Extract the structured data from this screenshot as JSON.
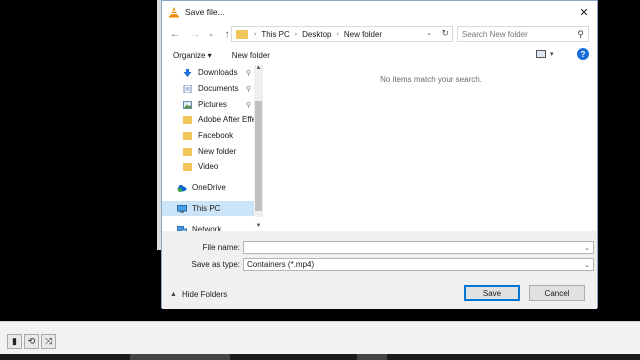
{
  "dialog": {
    "title": "Save file...",
    "close_glyph": "✕"
  },
  "address": {
    "crumbs": [
      "This PC",
      "Desktop",
      "New folder"
    ],
    "search_placeholder": "Search New folder"
  },
  "toolbar": {
    "organize_label": "Organize ▾",
    "new_folder_label": "New folder",
    "help_glyph": "?"
  },
  "nav": {
    "items": [
      {
        "label": "Downloads",
        "icon": "download-icon",
        "pinned": true
      },
      {
        "label": "Documents",
        "icon": "documents-icon",
        "pinned": true
      },
      {
        "label": "Pictures",
        "icon": "pictures-icon",
        "pinned": true
      },
      {
        "label": "Adobe After Effe",
        "icon": "folder-icon",
        "pinned": false
      },
      {
        "label": "Facebook",
        "icon": "folder-icon",
        "pinned": false
      },
      {
        "label": "New folder",
        "icon": "folder-icon",
        "pinned": false
      },
      {
        "label": "Video",
        "icon": "folder-icon",
        "pinned": false
      },
      {
        "label": "OneDrive",
        "icon": "cloud-icon",
        "pinned": false
      },
      {
        "label": "This PC",
        "icon": "computer-icon",
        "pinned": false,
        "selected": true
      },
      {
        "label": "Network",
        "icon": "network-icon",
        "pinned": false
      }
    ],
    "pin_glyph": "📌"
  },
  "content": {
    "empty_message": "No items match your search."
  },
  "form": {
    "file_name_label": "File name:",
    "file_name_value": "",
    "save_as_type_label": "Save as type:",
    "save_as_type_value": "Containers (*.mp4)"
  },
  "footer": {
    "hide_folders_label": "Hide Folders",
    "save_label": "Save",
    "cancel_label": "Cancel"
  },
  "player_controls": {
    "buttons": [
      "frame-icon",
      "loop-icon",
      "shuffle-icon"
    ]
  },
  "colors": {
    "accent": "#0078d7",
    "folder": "#f0c65a",
    "selected": "#cce4f7"
  }
}
